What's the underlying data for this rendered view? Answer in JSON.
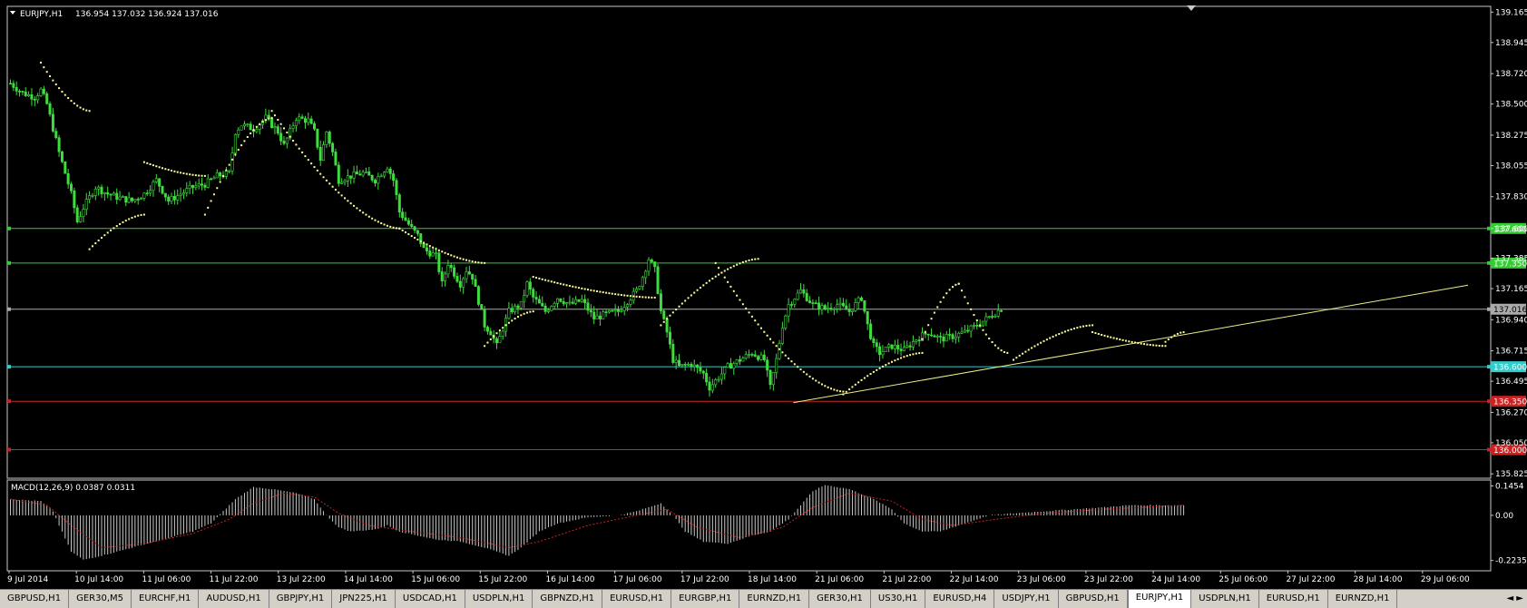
{
  "header": {
    "symbol_label": "EURJPY,H1",
    "ohlc": "136.954 137.032 136.924 137.016",
    "macd_label": "MACD(12,26,9) 0.0387 0.0311"
  },
  "colors": {
    "candle": "#3fdc3f",
    "sar": "#ffff99",
    "trendline": "#eeee88",
    "green_level": "#33cc33",
    "cyan_level": "#33cccc",
    "red_level": "#cc2222",
    "price_line": "#aaaaaa",
    "macd_hist": "#c8c8c8",
    "macd_signal": "#cc2222"
  },
  "chart_data": [
    {
      "type": "candlestick",
      "symbol": "EURJPY",
      "timeframe": "H1",
      "ylim": [
        135.8,
        139.2
      ],
      "y_ticks": [
        "139.165",
        "138.945",
        "138.720",
        "138.500",
        "138.275",
        "138.055",
        "137.830",
        "137.600",
        "137.385",
        "137.165",
        "136.940",
        "136.715",
        "136.495",
        "136.270",
        "136.050",
        "135.825"
      ],
      "x_ticks": [
        "9 Jul 2014",
        "10 Jul 14:00",
        "11 Jul 06:00",
        "11 Jul 22:00",
        "13 Jul 22:00",
        "14 Jul 14:00",
        "15 Jul 06:00",
        "15 Jul 22:00",
        "16 Jul 14:00",
        "17 Jul 06:00",
        "17 Jul 22:00",
        "18 Jul 14:00",
        "21 Jul 06:00",
        "21 Jul 22:00",
        "22 Jul 14:00",
        "23 Jul 06:00",
        "23 Jul 22:00",
        "24 Jul 14:00",
        "25 Jul 06:00",
        "27 Jul 22:00",
        "28 Jul 14:00",
        "29 Jul 06:00"
      ],
      "close_path": [
        [
          0,
          138.65
        ],
        [
          4,
          138.58
        ],
        [
          8,
          138.55
        ],
        [
          10,
          138.6
        ],
        [
          12,
          138.5
        ],
        [
          16,
          138.15
        ],
        [
          20,
          137.85
        ],
        [
          22,
          137.65
        ],
        [
          24,
          137.75
        ],
        [
          28,
          137.9
        ],
        [
          32,
          137.85
        ],
        [
          36,
          137.82
        ],
        [
          40,
          137.8
        ],
        [
          44,
          137.85
        ],
        [
          48,
          137.95
        ],
        [
          52,
          137.8
        ],
        [
          56,
          137.85
        ],
        [
          60,
          137.9
        ],
        [
          64,
          137.92
        ],
        [
          68,
          137.98
        ],
        [
          72,
          138.0
        ],
        [
          74,
          138.3
        ],
        [
          76,
          138.35
        ],
        [
          80,
          138.32
        ],
        [
          84,
          138.4
        ],
        [
          88,
          138.3
        ],
        [
          90,
          138.2
        ],
        [
          94,
          138.4
        ],
        [
          98,
          138.38
        ],
        [
          100,
          138.3
        ],
        [
          102,
          138.1
        ],
        [
          104,
          138.3
        ],
        [
          106,
          138.15
        ],
        [
          108,
          137.95
        ],
        [
          112,
          137.98
        ],
        [
          116,
          138.0
        ],
        [
          120,
          137.95
        ],
        [
          124,
          138.05
        ],
        [
          126,
          137.95
        ],
        [
          128,
          137.72
        ],
        [
          132,
          137.6
        ],
        [
          134,
          137.55
        ],
        [
          136,
          137.45
        ],
        [
          140,
          137.4
        ],
        [
          142,
          137.2
        ],
        [
          144,
          137.35
        ],
        [
          148,
          137.2
        ],
        [
          150,
          137.3
        ],
        [
          152,
          137.25
        ],
        [
          156,
          136.9
        ],
        [
          158,
          136.85
        ],
        [
          160,
          136.75
        ],
        [
          164,
          137.0
        ],
        [
          168,
          137.05
        ],
        [
          170,
          137.2
        ],
        [
          172,
          137.1
        ],
        [
          176,
          137.0
        ],
        [
          180,
          137.1
        ],
        [
          184,
          137.05
        ],
        [
          188,
          137.08
        ],
        [
          192,
          136.95
        ],
        [
          196,
          136.98
        ],
        [
          200,
          137.0
        ],
        [
          204,
          137.1
        ],
        [
          206,
          137.15
        ],
        [
          208,
          137.25
        ],
        [
          210,
          137.38
        ],
        [
          212,
          137.3
        ],
        [
          214,
          137.0
        ],
        [
          216,
          136.85
        ],
        [
          218,
          136.65
        ],
        [
          220,
          136.6
        ],
        [
          224,
          136.62
        ],
        [
          228,
          136.55
        ],
        [
          230,
          136.45
        ],
        [
          232,
          136.5
        ],
        [
          236,
          136.6
        ],
        [
          240,
          136.65
        ],
        [
          244,
          136.7
        ],
        [
          248,
          136.65
        ],
        [
          250,
          136.45
        ],
        [
          252,
          136.65
        ],
        [
          254,
          136.9
        ],
        [
          256,
          137.05
        ],
        [
          260,
          137.15
        ],
        [
          264,
          137.05
        ],
        [
          268,
          137.02
        ],
        [
          272,
          137.05
        ],
        [
          276,
          137.0
        ],
        [
          280,
          137.1
        ],
        [
          282,
          136.9
        ],
        [
          284,
          136.75
        ],
        [
          286,
          136.7
        ],
        [
          290,
          136.75
        ],
        [
          294,
          136.72
        ],
        [
          298,
          136.8
        ],
        [
          302,
          136.85
        ],
        [
          306,
          136.8
        ],
        [
          310,
          136.82
        ],
        [
          314,
          136.85
        ],
        [
          318,
          136.9
        ],
        [
          322,
          136.96
        ],
        [
          326,
          137.02
        ]
      ],
      "parabolic_sar": [
        {
          "x": [
            10,
            26
          ],
          "y": [
            138.8,
            138.45
          ]
        },
        {
          "x": [
            26,
            44
          ],
          "y": [
            137.45,
            137.7
          ]
        },
        {
          "x": [
            44,
            64
          ],
          "y": [
            138.08,
            137.98
          ]
        },
        {
          "x": [
            64,
            86
          ],
          "y": [
            137.7,
            138.4
          ]
        },
        {
          "x": [
            86,
            128
          ],
          "y": [
            138.45,
            137.6
          ]
        },
        {
          "x": [
            128,
            156
          ],
          "y": [
            137.6,
            137.35
          ]
        },
        {
          "x": [
            156,
            172
          ],
          "y": [
            136.75,
            137.0
          ]
        },
        {
          "x": [
            172,
            212
          ],
          "y": [
            137.25,
            137.1
          ]
        },
        {
          "x": [
            214,
            246
          ],
          "y": [
            136.9,
            137.38
          ]
        },
        {
          "x": [
            232,
            274
          ],
          "y": [
            137.35,
            136.42
          ]
        },
        {
          "x": [
            274,
            300
          ],
          "y": [
            136.4,
            136.7
          ]
        },
        {
          "x": [
            300,
            312
          ],
          "y": [
            136.8,
            137.2
          ]
        },
        {
          "x": [
            312,
            328
          ],
          "y": [
            137.2,
            136.7
          ]
        },
        {
          "x": [
            330,
            356
          ],
          "y": [
            136.65,
            136.9
          ]
        },
        {
          "x": [
            356,
            380
          ],
          "y": [
            136.85,
            136.75
          ]
        },
        {
          "x": [
            380,
            386
          ],
          "y": [
            136.78,
            136.85
          ]
        }
      ],
      "trendline": {
        "x1": 258,
        "y1": 136.34,
        "x2": 480,
        "y2": 137.19
      },
      "levels": [
        {
          "price": 137.6,
          "label": "137.600",
          "color_key": "green_level"
        },
        {
          "price": 137.35,
          "label": "137.350",
          "color_key": "green_level"
        },
        {
          "price": 137.016,
          "label": "137.016",
          "color_key": "price_line"
        },
        {
          "price": 136.6,
          "label": "136.600",
          "color_key": "cyan_level"
        },
        {
          "price": 136.35,
          "label": "136.350",
          "color_key": "red_level"
        },
        {
          "price": 136.0,
          "label": "136.000",
          "color_key": "red_level"
        }
      ]
    },
    {
      "type": "bar",
      "name": "MACD(12,26,9)",
      "ylim": [
        -0.27,
        0.17
      ],
      "y_ticks": [
        "0.1454",
        "0.00",
        "-0.2235"
      ],
      "hist_path": [
        [
          0,
          0.08
        ],
        [
          10,
          0.07
        ],
        [
          14,
          0.02
        ],
        [
          16,
          -0.05
        ],
        [
          20,
          -0.18
        ],
        [
          24,
          -0.22
        ],
        [
          30,
          -0.2
        ],
        [
          40,
          -0.16
        ],
        [
          50,
          -0.12
        ],
        [
          60,
          -0.08
        ],
        [
          66,
          -0.04
        ],
        [
          70,
          0.02
        ],
        [
          74,
          0.08
        ],
        [
          80,
          0.14
        ],
        [
          86,
          0.13
        ],
        [
          94,
          0.11
        ],
        [
          100,
          0.08
        ],
        [
          104,
          0.0
        ],
        [
          108,
          -0.06
        ],
        [
          112,
          -0.08
        ],
        [
          120,
          -0.07
        ],
        [
          124,
          -0.05
        ],
        [
          128,
          -0.08
        ],
        [
          134,
          -0.1
        ],
        [
          140,
          -0.12
        ],
        [
          148,
          -0.13
        ],
        [
          156,
          -0.16
        ],
        [
          164,
          -0.2
        ],
        [
          168,
          -0.16
        ],
        [
          174,
          -0.08
        ],
        [
          180,
          -0.04
        ],
        [
          190,
          -0.01
        ],
        [
          200,
          0.0
        ],
        [
          206,
          0.02
        ],
        [
          212,
          0.05
        ],
        [
          214,
          0.06
        ],
        [
          218,
          0.0
        ],
        [
          222,
          -0.08
        ],
        [
          228,
          -0.13
        ],
        [
          236,
          -0.14
        ],
        [
          244,
          -0.1
        ],
        [
          250,
          -0.08
        ],
        [
          256,
          -0.02
        ],
        [
          260,
          0.05
        ],
        [
          264,
          0.12
        ],
        [
          268,
          0.15
        ],
        [
          276,
          0.13
        ],
        [
          284,
          0.08
        ],
        [
          290,
          0.03
        ],
        [
          294,
          -0.04
        ],
        [
          300,
          -0.08
        ],
        [
          306,
          -0.08
        ],
        [
          314,
          -0.04
        ],
        [
          322,
          0.0
        ],
        [
          330,
          0.01
        ],
        [
          340,
          0.02
        ],
        [
          350,
          0.03
        ],
        [
          360,
          0.04
        ],
        [
          368,
          0.05
        ],
        [
          386,
          0.05
        ]
      ],
      "signal_path": [
        [
          0,
          0.08
        ],
        [
          12,
          0.05
        ],
        [
          20,
          -0.05
        ],
        [
          30,
          -0.16
        ],
        [
          44,
          -0.14
        ],
        [
          60,
          -0.09
        ],
        [
          72,
          -0.02
        ],
        [
          80,
          0.06
        ],
        [
          90,
          0.11
        ],
        [
          100,
          0.09
        ],
        [
          108,
          0.01
        ],
        [
          118,
          -0.05
        ],
        [
          132,
          -0.08
        ],
        [
          148,
          -0.11
        ],
        [
          164,
          -0.16
        ],
        [
          174,
          -0.13
        ],
        [
          190,
          -0.05
        ],
        [
          206,
          0.0
        ],
        [
          216,
          0.03
        ],
        [
          226,
          -0.06
        ],
        [
          240,
          -0.11
        ],
        [
          254,
          -0.06
        ],
        [
          264,
          0.04
        ],
        [
          276,
          0.11
        ],
        [
          290,
          0.07
        ],
        [
          300,
          -0.02
        ],
        [
          310,
          -0.05
        ],
        [
          324,
          -0.02
        ],
        [
          340,
          0.01
        ],
        [
          360,
          0.03
        ],
        [
          386,
          0.05
        ]
      ]
    }
  ],
  "tabs": [
    {
      "label": "GBPUSD,H1"
    },
    {
      "label": "GER30,M5"
    },
    {
      "label": "EURCHF,H1"
    },
    {
      "label": "AUDUSD,H1"
    },
    {
      "label": "GBPJPY,H1"
    },
    {
      "label": "JPN225,H1"
    },
    {
      "label": "USDCAD,H1"
    },
    {
      "label": "USDPLN,H1"
    },
    {
      "label": "GBPNZD,H1"
    },
    {
      "label": "EURUSD,H1"
    },
    {
      "label": "EURGBP,H1"
    },
    {
      "label": "EURNZD,H1"
    },
    {
      "label": "GER30,H1"
    },
    {
      "label": "US30,H1"
    },
    {
      "label": "EURUSD,H4"
    },
    {
      "label": "USDJPY,H1"
    },
    {
      "label": "GBPUSD,H1"
    },
    {
      "label": "EURJPY,H1",
      "active": true
    },
    {
      "label": "USDPLN,H1"
    },
    {
      "label": "EURUSD,H1"
    },
    {
      "label": "EURNZD,H1"
    }
  ]
}
